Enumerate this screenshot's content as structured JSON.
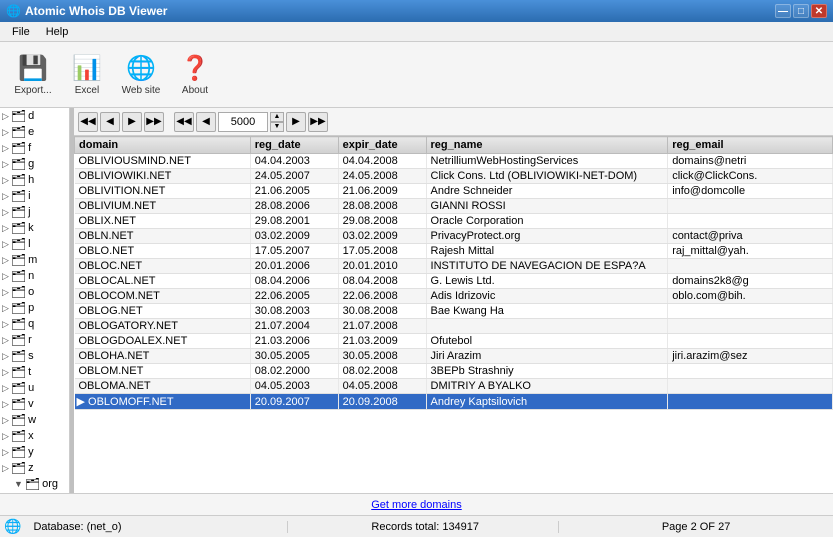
{
  "app": {
    "title": "Atomic Whois DB Viewer",
    "icon": "🌐"
  },
  "window_controls": {
    "minimize": "—",
    "maximize": "□",
    "close": "✕"
  },
  "menu": {
    "items": [
      "File",
      "Help"
    ]
  },
  "toolbar": {
    "buttons": [
      {
        "id": "save",
        "icon": "💾",
        "label": "Export..."
      },
      {
        "id": "excel",
        "icon": "📊",
        "label": "Excel"
      },
      {
        "id": "web",
        "icon": "🌐",
        "label": "Web site"
      },
      {
        "id": "about",
        "icon": "❓",
        "label": "About"
      }
    ]
  },
  "nav": {
    "page_value": "5000",
    "arrows": [
      "◀◀",
      "◀",
      "▶",
      "▶▶",
      "◀◀",
      "◀",
      "▶▶"
    ]
  },
  "sidebar": {
    "items": [
      {
        "label": "d",
        "icon": "🗂",
        "indent": false
      },
      {
        "label": "e",
        "icon": "🗂",
        "indent": false
      },
      {
        "label": "f",
        "icon": "🗂",
        "indent": false
      },
      {
        "label": "g",
        "icon": "🗂",
        "indent": false
      },
      {
        "label": "h",
        "icon": "🗂",
        "indent": false
      },
      {
        "label": "i",
        "icon": "🗂",
        "indent": false
      },
      {
        "label": "j",
        "icon": "🗂",
        "indent": false
      },
      {
        "label": "k",
        "icon": "🗂",
        "indent": false
      },
      {
        "label": "l",
        "icon": "🗂",
        "indent": false
      },
      {
        "label": "m",
        "icon": "🗂",
        "indent": false
      },
      {
        "label": "n",
        "icon": "🗂",
        "indent": false
      },
      {
        "label": "o",
        "icon": "🗂",
        "indent": false
      },
      {
        "label": "p",
        "icon": "🗂",
        "indent": false
      },
      {
        "label": "q",
        "icon": "🗂",
        "indent": false
      },
      {
        "label": "r",
        "icon": "🗂",
        "indent": false
      },
      {
        "label": "s",
        "icon": "🗂",
        "indent": false
      },
      {
        "label": "t",
        "icon": "🗂",
        "indent": false
      },
      {
        "label": "u",
        "icon": "🗂",
        "indent": false
      },
      {
        "label": "v",
        "icon": "🗂",
        "indent": false
      },
      {
        "label": "w",
        "icon": "🗂",
        "indent": false
      },
      {
        "label": "x",
        "icon": "🗂",
        "indent": false
      },
      {
        "label": "y",
        "icon": "🗂",
        "indent": false
      },
      {
        "label": "z",
        "icon": "🗂",
        "indent": false
      },
      {
        "label": "org",
        "icon": "🗂",
        "indent": true,
        "expand": true
      }
    ]
  },
  "table": {
    "columns": [
      "domain",
      "reg_date",
      "expir_date",
      "reg_name",
      "reg_email"
    ],
    "rows": [
      {
        "domain": "OBLIVIOUSMIND.NET",
        "reg_date": "04.04.2003",
        "expir_date": "04.04.2008",
        "reg_name": "NetrilliumWebHostingServices",
        "reg_email": "domains@netri",
        "selected": false,
        "alt": false
      },
      {
        "domain": "OBLIVIOWIKI.NET",
        "reg_date": "24.05.2007",
        "expir_date": "24.05.2008",
        "reg_name": "Click Cons. Ltd (OBLIVIOWIKI-NET-DOM)",
        "reg_email": "click@ClickCons.",
        "selected": false,
        "alt": true
      },
      {
        "domain": "OBLIVITION.NET",
        "reg_date": "21.06.2005",
        "expir_date": "21.06.2009",
        "reg_name": "Andre Schneider",
        "reg_email": "info@domcolle",
        "selected": false,
        "alt": false
      },
      {
        "domain": "OBLIVIUM.NET",
        "reg_date": "28.08.2006",
        "expir_date": "28.08.2008",
        "reg_name": "GIANNI ROSSI",
        "reg_email": "",
        "selected": false,
        "alt": true
      },
      {
        "domain": "OBLIX.NET",
        "reg_date": "29.08.2001",
        "expir_date": "29.08.2008",
        "reg_name": "Oracle Corporation",
        "reg_email": "",
        "selected": false,
        "alt": false
      },
      {
        "domain": "OBLN.NET",
        "reg_date": "03.02.2009",
        "expir_date": "03.02.2009",
        "reg_name": "PrivacyProtect.org",
        "reg_email": "contact@priva",
        "selected": false,
        "alt": true
      },
      {
        "domain": "OBLO.NET",
        "reg_date": "17.05.2007",
        "expir_date": "17.05.2008",
        "reg_name": "Rajesh Mittal",
        "reg_email": "raj_mittal@yah.",
        "selected": false,
        "alt": false
      },
      {
        "domain": "OBLOC.NET",
        "reg_date": "20.01.2006",
        "expir_date": "20.01.2010",
        "reg_name": "INSTITUTO DE NAVEGACION DE ESPA?A",
        "reg_email": "",
        "selected": false,
        "alt": true
      },
      {
        "domain": "OBLOCAL.NET",
        "reg_date": "08.04.2006",
        "expir_date": "08.04.2008",
        "reg_name": "G. Lewis Ltd.",
        "reg_email": "domains2k8@g",
        "selected": false,
        "alt": false
      },
      {
        "domain": "OBLOCOM.NET",
        "reg_date": "22.06.2005",
        "expir_date": "22.06.2008",
        "reg_name": "Adis Idrizovic",
        "reg_email": "oblo.com@bih.",
        "selected": false,
        "alt": true
      },
      {
        "domain": "OBLOG.NET",
        "reg_date": "30.08.2003",
        "expir_date": "30.08.2008",
        "reg_name": "Bae Kwang Ha",
        "reg_email": "",
        "selected": false,
        "alt": false
      },
      {
        "domain": "OBLOGATORY.NET",
        "reg_date": "21.07.2004",
        "expir_date": "21.07.2008",
        "reg_name": "",
        "reg_email": "",
        "selected": false,
        "alt": true
      },
      {
        "domain": "OBLOGDOALEX.NET",
        "reg_date": "21.03.2006",
        "expir_date": "21.03.2009",
        "reg_name": "Ofutebol",
        "reg_email": "",
        "selected": false,
        "alt": false
      },
      {
        "domain": "OBLOHA.NET",
        "reg_date": "30.05.2005",
        "expir_date": "30.05.2008",
        "reg_name": "Jiri Arazim",
        "reg_email": "jiri.arazim@sez",
        "selected": false,
        "alt": true
      },
      {
        "domain": "OBLOM.NET",
        "reg_date": "08.02.2000",
        "expir_date": "08.02.2008",
        "reg_name": "3BEPb Strashniy",
        "reg_email": "",
        "selected": false,
        "alt": false
      },
      {
        "domain": "OBLOMA.NET",
        "reg_date": "04.05.2003",
        "expir_date": "04.05.2008",
        "reg_name": "DMITRIY A BYALKO",
        "reg_email": "",
        "selected": false,
        "alt": true
      },
      {
        "domain": "OBLOMOFF.NET",
        "reg_date": "20.09.2007",
        "expir_date": "20.09.2008",
        "reg_name": "Andrey Kaptsilovich",
        "reg_email": "",
        "selected": true,
        "alt": false
      }
    ]
  },
  "link_bar": {
    "text": "Get more domains"
  },
  "status_bar": {
    "database": "Database: (net_o)",
    "records": "Records total: 134917",
    "page": "Page 2 OF 27"
  }
}
